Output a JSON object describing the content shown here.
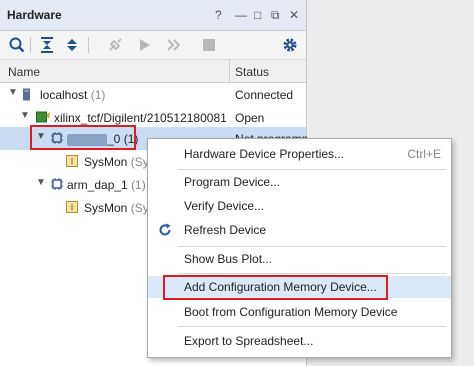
{
  "panel": {
    "title": "Hardware",
    "controls": [
      "?",
      "—",
      "□",
      "⧉",
      "✕"
    ]
  },
  "toolbar": {
    "icons": [
      "search-icon",
      "collapse-all-icon",
      "expand-all-icon",
      "auto-connect-icon",
      "run-icon",
      "step-icon",
      "stop-icon",
      "settings-icon"
    ]
  },
  "table": {
    "headers": {
      "name": "Name",
      "status": "Status"
    },
    "rows": [
      {
        "name": "localhost",
        "count": "(1)",
        "status": "Connected"
      },
      {
        "name": "xilinx_tcf/Digilent/210512180081",
        "status": "Open"
      },
      {
        "name": "_0",
        "count": "(1)",
        "status": "Not programm..."
      },
      {
        "name": "SysMon",
        "suffix": "(Sys"
      },
      {
        "name": "arm_dap_1",
        "count": "(1)"
      },
      {
        "name": "SysMon",
        "suffix": "(Sys"
      }
    ]
  },
  "context_menu": {
    "items": [
      {
        "label": "Hardware Device Properties...",
        "shortcut": "Ctrl+E"
      },
      {
        "label": "Program Device..."
      },
      {
        "label": "Verify Device..."
      },
      {
        "label": "Refresh Device"
      },
      {
        "label": "Show Bus Plot..."
      },
      {
        "label": "Add Configuration Memory Device..."
      },
      {
        "label": "Boot from Configuration Memory Device"
      },
      {
        "label": "Export to Spreadsheet..."
      }
    ]
  },
  "colors": {
    "highlight_box": "#e11b22",
    "selection": "#c9dcf2",
    "title_bar": "#e4eaf4"
  }
}
